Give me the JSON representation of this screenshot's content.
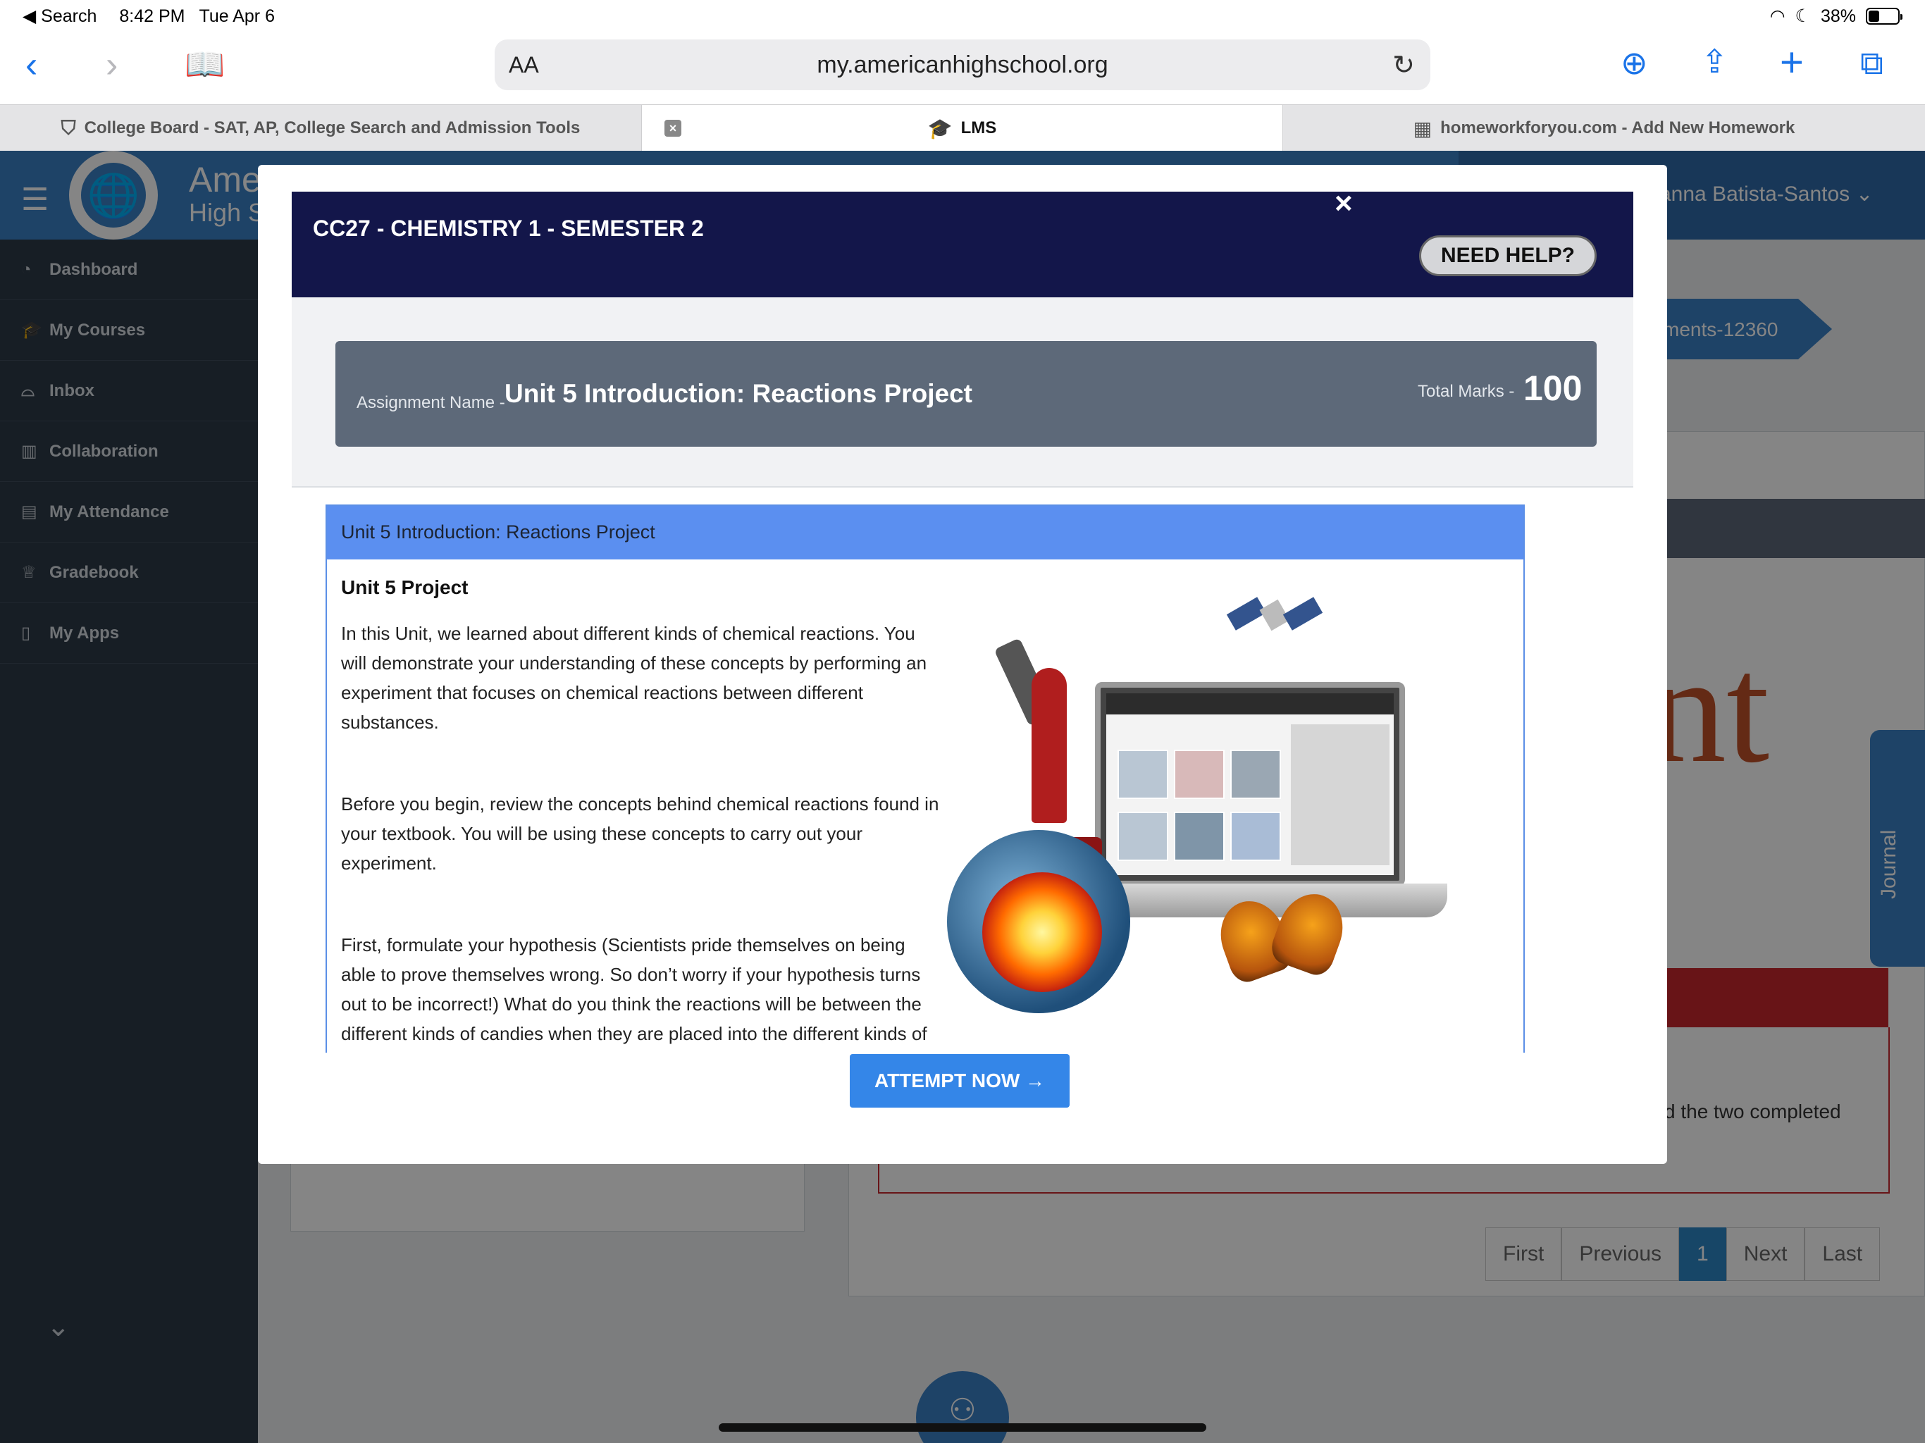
{
  "status_bar": {
    "back_label": "◀ Search",
    "time": "8:42 PM",
    "date": "Tue Apr 6",
    "battery": "38%",
    "battery_level": 0.38
  },
  "browser": {
    "text_size_label": "AA",
    "url": "my.americanhighschool.org"
  },
  "tabs": [
    {
      "label": "College Board - SAT, AP, College Search and Admission Tools"
    },
    {
      "label": "LMS"
    },
    {
      "label": "homeworkforyou.com - Add New Homework"
    }
  ],
  "app_header": {
    "school_line1": "Ame",
    "school_line2": "High S",
    "user_name": "vanna Batista-Santos"
  },
  "sidebar": {
    "items": [
      {
        "label": "Dashboard",
        "icon": "dashboard-icon"
      },
      {
        "label": "My Courses",
        "icon": "graduation-cap-icon"
      },
      {
        "label": "Inbox",
        "icon": "inbox-icon"
      },
      {
        "label": "Collaboration",
        "icon": "collaboration-icon"
      },
      {
        "label": "My Attendance",
        "icon": "clipboard-icon"
      },
      {
        "label": "Gradebook",
        "icon": "trophy-icon"
      },
      {
        "label": "My Apps",
        "icon": "mobile-icon"
      }
    ]
  },
  "background_page": {
    "breadcrumb": "ments-12360",
    "big_text": "nt",
    "snippet": "d the two completed",
    "journal_label": "Journal",
    "pagination": [
      "First",
      "Previous",
      "1",
      "Next",
      "Last"
    ]
  },
  "modal": {
    "course_title": "CC27 - CHEMISTRY 1 - SEMESTER 2",
    "help_label": "NEED HELP?",
    "close_label": "×",
    "assignment_label": "Assignment Name -",
    "assignment_name": "Unit 5 Introduction: Reactions Project",
    "total_marks_label": "Total Marks -",
    "total_marks": "100",
    "panel_title": "Unit 5 Introduction: Reactions Project",
    "project_heading": "Unit 5 Project",
    "paragraphs": [
      "In this Unit, we learned about different kinds of chemical reactions. You will demonstrate your understanding of these concepts by performing an experiment that focuses on chemical reactions between different substances.",
      "Before you begin, review the concepts behind chemical reactions found in your textbook. You will be using these concepts to carry out your experiment.",
      "First, formulate your hypothesis (Scientists pride themselves on being able to prove themselves wrong. So don’t worry if your hypothesis turns out to be incorrect!) What do you think the reactions will be between the different kinds of candies when they are placed into the different kinds of soda? Record your predictions. Remember to record a hypothesis for each separate type of candy, combined with each different type of soda."
    ],
    "attempt_label": "ATTEMPT NOW →"
  },
  "colors": {
    "header_blue": "#3b80c6",
    "sidebar_bg": "#2d3a47",
    "modal_header": "#13164a",
    "panel_blue": "#5b8ff0",
    "attempt_button": "#3486e8"
  }
}
